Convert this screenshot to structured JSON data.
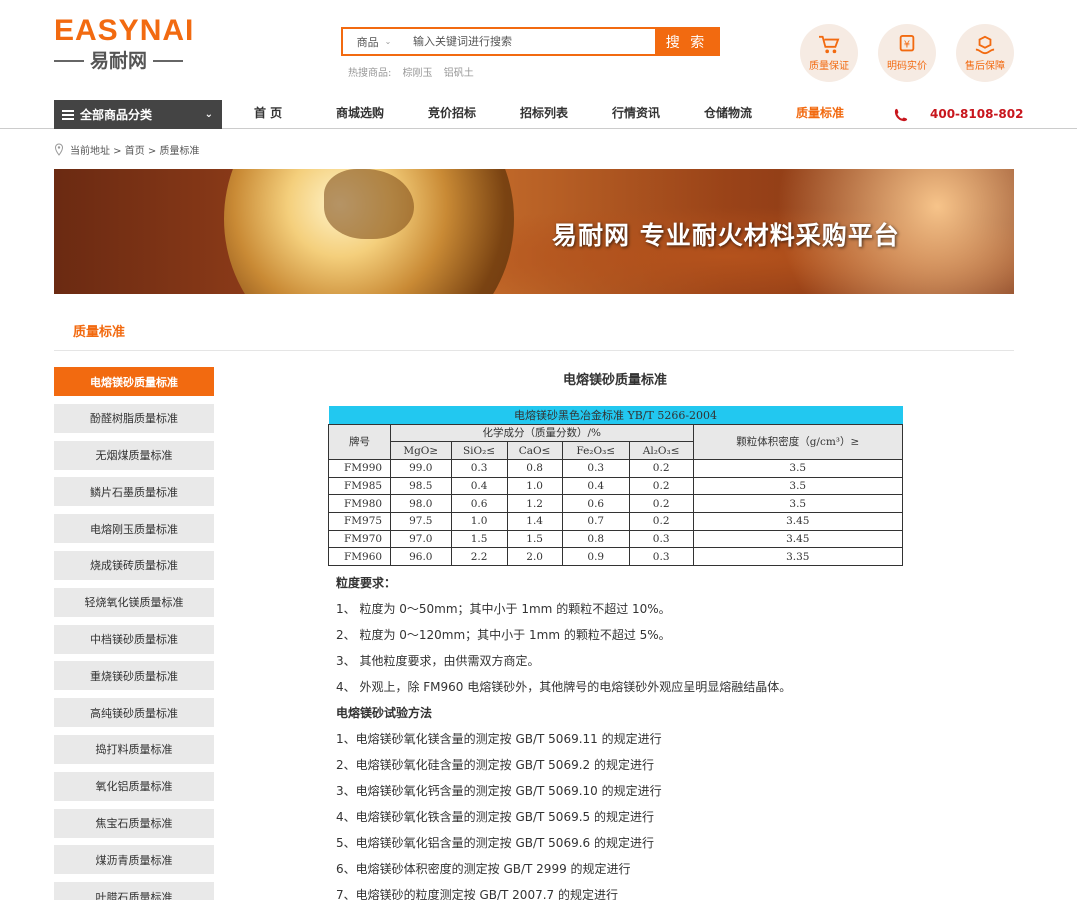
{
  "header": {
    "logo_en": "EASYNAI",
    "logo_cn": "易耐网",
    "search_category": "商品",
    "search_placeholder": "输入关键词进行搜索",
    "search_button": "搜 索",
    "hot_label": "热搜商品:",
    "hot_items": [
      "棕刚玉",
      "铝矾土"
    ],
    "guarantees": [
      "质量保证",
      "明码实价",
      "售后保障"
    ]
  },
  "nav": {
    "category": "全部商品分类",
    "items": [
      "首 页",
      "商城选购",
      "竞价招标",
      "招标列表",
      "行情资讯",
      "仓储物流",
      "质量标准"
    ],
    "phone": "400-8108-802"
  },
  "breadcrumb": "当前地址 > 首页 > 质量标准",
  "banner": {
    "text": "易耐网  专业耐火材料采购平台"
  },
  "section_title": "质量标准",
  "sidebar": {
    "items": [
      "电熔镁砂质量标准",
      "酚醛树脂质量标准",
      "无烟煤质量标准",
      "鳞片石墨质量标准",
      "电熔刚玉质量标准",
      "烧成镁砖质量标准",
      "轻烧氧化镁质量标准",
      "中档镁砂质量标准",
      "重烧镁砂质量标准",
      "高纯镁砂质量标准",
      "捣打料质量标准",
      "氧化铝质量标准",
      "焦宝石质量标准",
      "煤沥青质量标准",
      "叶腊石质量标准"
    ]
  },
  "content": {
    "title": "电熔镁砂质量标准",
    "table": {
      "caption": "电熔镁砂黑色冶金标准 YB/T 5266-2004",
      "col_grade": "牌号",
      "col_chem": "化学成分（质量分数）/%",
      "col_density": "颗粒体积密度（g/cm³）≥",
      "chem_cols": [
        "MgO≥",
        "SiO₂≤",
        "CaO≤",
        "Fe₂O₃≤",
        "Al₂O₃≤"
      ],
      "rows": [
        [
          "FM990",
          "99.0",
          "0.3",
          "0.8",
          "0.3",
          "0.2",
          "3.5"
        ],
        [
          "FM985",
          "98.5",
          "0.4",
          "1.0",
          "0.4",
          "0.2",
          "3.5"
        ],
        [
          "FM980",
          "98.0",
          "0.6",
          "1.2",
          "0.6",
          "0.2",
          "3.5"
        ],
        [
          "FM975",
          "97.5",
          "1.0",
          "1.4",
          "0.7",
          "0.2",
          "3.45"
        ],
        [
          "FM970",
          "97.0",
          "1.5",
          "1.5",
          "0.8",
          "0.3",
          "3.45"
        ],
        [
          "FM960",
          "96.0",
          "2.2",
          "2.0",
          "0.9",
          "0.3",
          "3.35"
        ]
      ]
    },
    "particle_title": "粒度要求：",
    "particle_items": [
      "1、 粒度为 0～50mm；其中小于 1mm 的颗粒不超过 10%。",
      "2、 粒度为 0～120mm；其中小于 1mm 的颗粒不超过 5%。",
      "3、 其他粒度要求，由供需双方商定。",
      "4、 外观上，除 FM960 电熔镁砂外，其他牌号的电熔镁砂外观应呈明显熔融结晶体。"
    ],
    "method_title": "电熔镁砂试验方法",
    "method_items": [
      "1、电熔镁砂氧化镁含量的测定按 GB/T 5069.11 的规定进行",
      "2、电熔镁砂氧化硅含量的测定按 GB/T 5069.2 的规定进行",
      "3、电熔镁砂氧化钙含量的测定按 GB/T 5069.10 的规定进行",
      "4、电熔镁砂氧化铁含量的测定按 GB/T 5069.5 的规定进行",
      "5、电熔镁砂氧化铝含量的测定按 GB/T 5069.6 的规定进行",
      "6、电熔镁砂体积密度的测定按 GB/T 2999 的规定进行",
      "7、电熔镁砂的粒度测定按 GB/T 2007.7 的规定进行"
    ]
  },
  "colors": {
    "accent": "#f26a10",
    "nav_dark": "#444444",
    "phone": "#c8161d",
    "table_caption": "#22c8f0"
  }
}
